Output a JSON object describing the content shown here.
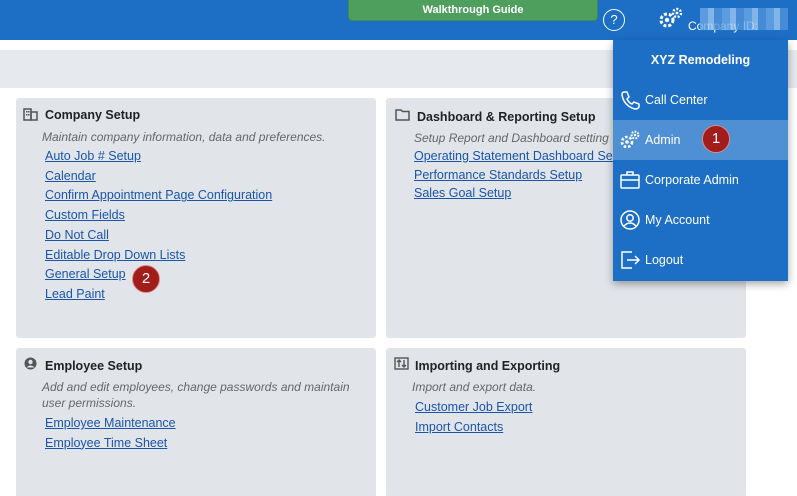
{
  "header": {
    "walkthrough_label": "Walkthrough Guide",
    "help_label": "?",
    "company_id_label": "Company ID:"
  },
  "cards": {
    "company_setup": {
      "title": "Company Setup",
      "description": "Maintain company information, data and preferences.",
      "links": [
        "Auto Job # Setup",
        "Calendar",
        "Confirm Appointment Page Configuration",
        "Custom Fields",
        "Do Not Call",
        "Editable Drop Down Lists",
        "General Setup",
        "Lead Paint"
      ]
    },
    "dashboard_reporting": {
      "title": "Dashboard & Reporting Setup",
      "description": "Setup Report and Dashboard setting",
      "links": [
        "Operating Statement Dashboard Se",
        "Performance Standards Setup",
        "Sales Goal Setup"
      ]
    },
    "employee_setup": {
      "title": "Employee Setup",
      "description": "Add and edit employees, change passwords and maintain user permissions.",
      "links": [
        "Employee Maintenance",
        "Employee Time Sheet"
      ]
    },
    "import_export": {
      "title": "Importing and Exporting",
      "description": "Import and export data.",
      "links": [
        "Customer Job Export",
        "Import Contacts"
      ]
    }
  },
  "menu": {
    "company_name": "XYZ Remodeling",
    "items": [
      {
        "label": "Call Center",
        "icon": "phone-icon"
      },
      {
        "label": "Admin",
        "icon": "gears-icon"
      },
      {
        "label": "Corporate Admin",
        "icon": "briefcase-icon"
      },
      {
        "label": "My Account",
        "icon": "user-circle-icon"
      },
      {
        "label": "Logout",
        "icon": "logout-icon"
      }
    ]
  },
  "steps": {
    "one": "1",
    "two": "2"
  },
  "colors": {
    "brand_blue": "#1d6ec5",
    "active_blue": "#4f8fd4",
    "link": "#1a55a8",
    "badge_red": "#a31c1c",
    "card_bg": "#e1e5ea",
    "walkthrough_green": "#4e9f5e"
  }
}
